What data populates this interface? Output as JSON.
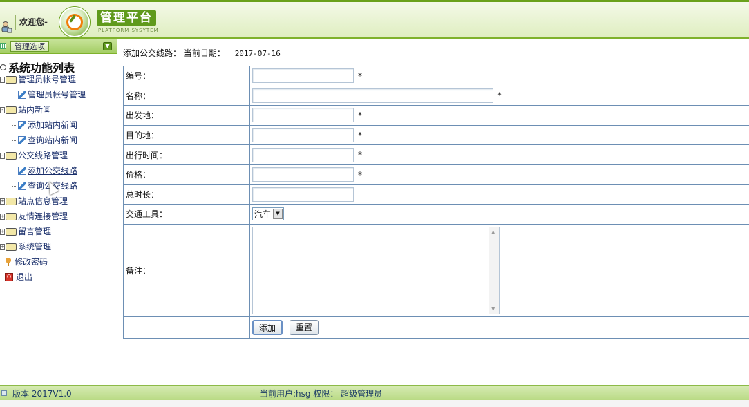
{
  "header": {
    "welcome": "欢迎您-",
    "logo_title": "管理平台",
    "logo_subtitle": "PLATFORM SYSYTEM"
  },
  "sidebar": {
    "options_button": "管理选项",
    "root_title": "系统功能列表",
    "groups": [
      {
        "label": "管理员帐号管理",
        "expander": "-",
        "children": [
          "管理员帐号管理"
        ]
      },
      {
        "label": "站内新闻",
        "expander": "-",
        "children": [
          "添加站内新闻",
          "查询站内新闻"
        ]
      },
      {
        "label": "公交线路管理",
        "expander": "-",
        "children": [
          "添加公交线路",
          "查询公交线路"
        ]
      },
      {
        "label": "站点信息管理",
        "expander": "+"
      },
      {
        "label": "友情连接管理",
        "expander": "+"
      },
      {
        "label": "留言管理",
        "expander": "+"
      },
      {
        "label": "系统管理",
        "expander": "+"
      }
    ],
    "items": [
      {
        "label": "修改密码",
        "icon": "key-icon"
      },
      {
        "label": "退出",
        "icon": "exit-icon"
      }
    ]
  },
  "main": {
    "breadcrumb": "添加公交线路：",
    "date_label": "当前日期：",
    "date_value": "2017-07-16",
    "required_mark": "*",
    "fields": {
      "code": "编号：",
      "name": "名称：",
      "origin": "出发地：",
      "destination": "目的地：",
      "depart_time": "出行时间：",
      "price": "价格：",
      "duration": "总时长：",
      "vehicle": "交通工具：",
      "remark": "备注："
    },
    "vehicle_selected": "汽车",
    "add_button": "添加",
    "reset_button": "重置"
  },
  "footer": {
    "version": "版本 2017V1.0",
    "current_user": "当前用户:hsg 权限： 超级管理员"
  }
}
